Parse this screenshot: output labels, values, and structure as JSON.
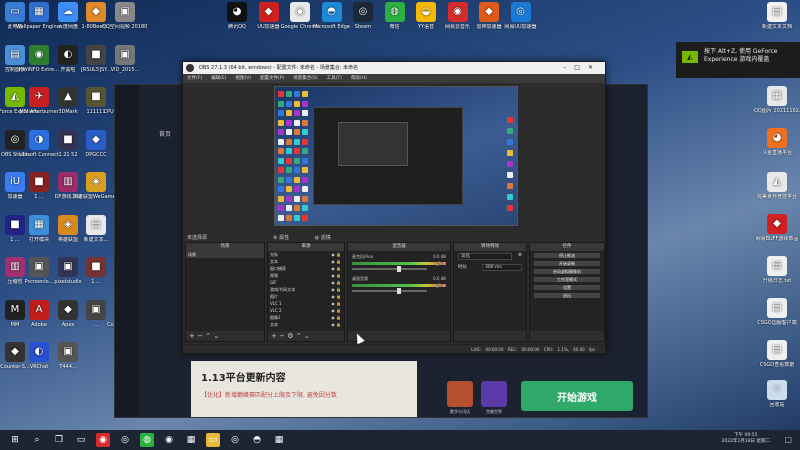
{
  "desktop_left": [
    {
      "label": "此电脑",
      "icon": "computer-icon",
      "color": "#3a7bd5",
      "glyph": "▭"
    },
    {
      "label": "Wallpaper Engine: ...",
      "icon": "wallpaper-engine-icon",
      "color": "#2f6fd1",
      "glyph": "▦"
    },
    {
      "label": "百度网盘",
      "icon": "baidu-netdisk-icon",
      "color": "#3e8ef7",
      "glyph": "☁"
    },
    {
      "label": "1-80Beetl...",
      "icon": "cs-game-icon",
      "color": "#e08a2c",
      "glyph": "◆"
    },
    {
      "label": "QQ空间视频 2018071...",
      "icon": "video-file-icon",
      "color": "#888",
      "glyph": "▣"
    },
    {
      "label": "控制面板",
      "icon": "control-panel-icon",
      "color": "#4a8fd8",
      "glyph": "▤"
    },
    {
      "label": "HWiNFO Extre...",
      "icon": "hwinfo-icon",
      "color": "#2d7f2d",
      "glyph": "◉"
    },
    {
      "label": "开黑啦",
      "icon": "kaiheila-icon",
      "color": "#222",
      "glyph": "◐"
    },
    {
      "label": "[RSUL5]SY...",
      "icon": "app-icon",
      "color": "#444",
      "glyph": "■"
    },
    {
      "label": "VID_2015...",
      "icon": "video-file-icon",
      "color": "#777",
      "glyph": "▣"
    },
    {
      "label": "GeForce Experience",
      "icon": "geforce-icon",
      "color": "#76b900",
      "glyph": "◭"
    },
    {
      "label": "MSI Afterburner",
      "icon": "msi-afterburner-icon",
      "color": "#c82020",
      "glyph": "✈"
    },
    {
      "label": "3DMark",
      "icon": "3dmark-icon",
      "color": "#333",
      "glyph": "▲"
    },
    {
      "label": "111111",
      "icon": "app-icon",
      "color": "#553",
      "glyph": "■"
    },
    {
      "label": "CPUID CPU-Z MSI",
      "icon": "cpuz-icon",
      "color": "#8a1c1c",
      "glyph": "▩"
    },
    {
      "label": "OBS Studio",
      "icon": "obs-icon",
      "color": "#222",
      "glyph": "◎"
    },
    {
      "label": "Ubisoft Connect",
      "icon": "ubisoft-icon",
      "color": "#2a6fe0",
      "glyph": "◑"
    },
    {
      "label": "1 21 52",
      "icon": "app-icon",
      "color": "#335",
      "glyph": "■"
    },
    {
      "label": "DPGCCC",
      "icon": "app-icon",
      "color": "#2a5dc6",
      "glyph": "◆"
    },
    {
      "label": "英雄联盟",
      "icon": "lol-icon",
      "color": "#2060c0",
      "glyph": "▲"
    },
    {
      "label": "加速器",
      "icon": "accelerator-icon",
      "color": "#3b7df0",
      "glyph": "iU"
    },
    {
      "label": "1 ...",
      "icon": "app-icon",
      "color": "#822",
      "glyph": "■"
    },
    {
      "label": "DP游戏工具",
      "icon": "winrar-icon",
      "color": "#9a2c6a",
      "glyph": "▥"
    },
    {
      "label": "英雄联盟WeGame版",
      "icon": "wegame-icon",
      "color": "#d8a020",
      "glyph": "◈"
    },
    {
      "label": "Origin",
      "icon": "origin-icon",
      "color": "#f06a20",
      "glyph": "◉"
    },
    {
      "label": "1 ...",
      "icon": "app-icon",
      "color": "#228",
      "glyph": "■"
    },
    {
      "label": "打开模块",
      "icon": "app-icon",
      "color": "#3c8fd8",
      "glyph": "▦"
    },
    {
      "label": "英雄联盟",
      "icon": "app-icon",
      "color": "#d88a20",
      "glyph": "◈"
    },
    {
      "label": "新建文本...",
      "icon": "text-file-icon",
      "color": "#e8e8e8",
      "glyph": "▤"
    },
    {
      "label": "...",
      "icon": "app-icon",
      "color": "#666",
      "glyph": "■"
    },
    {
      "label": "压缩包",
      "icon": "winrar-icon",
      "color": "#a03070",
      "glyph": "▥"
    },
    {
      "label": "Pscreenlo...",
      "icon": "app-icon",
      "color": "#555",
      "glyph": "▣"
    },
    {
      "label": "pixelstudio",
      "icon": "app-icon",
      "color": "#335",
      "glyph": "▣"
    },
    {
      "label": "1 ...",
      "icon": "app-icon",
      "color": "#733",
      "glyph": "■"
    },
    {
      "label": "Steam",
      "icon": "app-icon",
      "color": "#555",
      "glyph": "▣"
    },
    {
      "label": "MM",
      "icon": "app-icon",
      "color": "#222",
      "glyph": "M"
    },
    {
      "label": "Adobe",
      "icon": "adobe-icon",
      "color": "#c21c1c",
      "glyph": "A"
    },
    {
      "label": "Apex",
      "icon": "app-icon",
      "color": "#333",
      "glyph": "◆"
    },
    {
      "label": "...",
      "icon": "app-icon",
      "color": "#444",
      "glyph": "▣"
    },
    {
      "label": "Counter-Strike",
      "icon": "cs-icon",
      "color": "#d67a1a",
      "glyph": "◆"
    },
    {
      "label": "Counter-S...",
      "icon": "cs-icon",
      "color": "#333",
      "glyph": "◆"
    },
    {
      "label": "VRChat",
      "icon": "app-icon",
      "color": "#2a4fd0",
      "glyph": "◐"
    },
    {
      "label": "T444...",
      "icon": "app-icon",
      "color": "#555",
      "glyph": "▣"
    }
  ],
  "desktop_top": [
    {
      "label": "腾讯QQ",
      "icon": "qq-icon",
      "color": "#111",
      "glyph": "◕"
    },
    {
      "label": "UU加速器",
      "icon": "gamecenter-icon",
      "color": "#d02020",
      "glyph": "◆"
    },
    {
      "label": "Google Chrome",
      "icon": "chrome-icon",
      "color": "#e8e8e8",
      "glyph": "◉"
    },
    {
      "label": "Microsoft Edge",
      "icon": "edge-icon",
      "color": "#1e8ad6",
      "glyph": "◓"
    },
    {
      "label": "Steam",
      "icon": "steam-icon",
      "color": "#1b2838",
      "glyph": "◎"
    },
    {
      "label": "微信",
      "icon": "wechat-icon",
      "color": "#2bb140",
      "glyph": "◍"
    },
    {
      "label": "YY语音",
      "icon": "yy-icon",
      "color": "#f5b800",
      "glyph": "◒"
    },
    {
      "label": "网易云音乐",
      "icon": "netease-music-icon",
      "color": "#d42c2c",
      "glyph": "◉"
    },
    {
      "label": "雷神加速器",
      "icon": "leishen-icon",
      "color": "#e05a1a",
      "glyph": "◆"
    },
    {
      "label": "网易UU加速器",
      "icon": "uu-icon",
      "color": "#1a7ad6",
      "glyph": "◎"
    }
  ],
  "desktop_right": [
    {
      "label": "新建文本文档",
      "icon": "text-file-icon",
      "color": "#f0f0f0",
      "glyph": "▤"
    },
    {
      "label": "QQ图片 20211102...",
      "icon": "image-file-icon",
      "color": "#e8e8e8",
      "glyph": "▦"
    },
    {
      "label": "斗鱼直播平台",
      "icon": "douyu-icon",
      "color": "#f07020",
      "glyph": "◕"
    },
    {
      "label": "完美世界竞技平台",
      "icon": "perfect-world-icon",
      "color": "#e8e8e8",
      "glyph": "◭"
    },
    {
      "label": "网易BUFF游戏饰品",
      "icon": "buff-icon",
      "color": "#d02020",
      "glyph": "◆"
    },
    {
      "label": "升级日志.txt",
      "icon": "text-file-icon",
      "color": "#f0f0f0",
      "glyph": "▤"
    },
    {
      "label": "CSGO国服客户端",
      "icon": "text-file-icon",
      "color": "#f0f0f0",
      "glyph": "▤"
    },
    {
      "label": "CSGO查看数据",
      "icon": "text-file-icon",
      "color": "#f0f0f0",
      "glyph": "▤"
    },
    {
      "label": "回收站",
      "icon": "recycle-bin-icon",
      "color": "#cde",
      "glyph": "♲"
    }
  ],
  "obs": {
    "title": "OBS 27.1.3 (64 bit, windows) - 配置文件: 未命名 - 场景集合: 未命名",
    "menu": [
      "文件(F)",
      "编辑(E)",
      "视图(V)",
      "配置文件(P)",
      "场景集合(S)",
      "工具(T)",
      "帮助(H)"
    ],
    "no_source": "未选择源",
    "props_tab": "属性",
    "filters_tab": "滤镜",
    "docks": {
      "scenes": {
        "title": "场景",
        "items": [
          "场景"
        ]
      },
      "sources": {
        "title": "来源",
        "items": [
          "光标",
          "文本",
          "窗口捕获",
          "视频",
          "GIF",
          "游戏/代码文本",
          "图片",
          "VLC 1",
          "VLC 2",
          "图像2",
          "文本"
        ]
      },
      "mixer": {
        "title": "混音器",
        "channels": [
          {
            "name": "麦克风/Aux",
            "db": "0.0 dB"
          },
          {
            "name": "桌面音频",
            "db": "0.0 dB"
          }
        ]
      },
      "transitions": {
        "title": "转场特效",
        "type_value": "淡化",
        "duration_label": "时长",
        "duration_value": "300 ms"
      },
      "controls": {
        "title": "控件",
        "buttons": [
          "停止推流",
          "开始录制",
          "启动虚拟摄像机",
          "工作室模式",
          "设置",
          "退出"
        ]
      }
    },
    "status": [
      "LIVE: 00:00:00",
      "REC: 00:00:00",
      "CPU: 1.1%, 60.00 fps"
    ]
  },
  "bgapp": {
    "home_tab": "首页",
    "news_title": "1.13平台更新内容",
    "news_sub": "【优化】新增巅峰赛匹配分上限及下限, 避免因分数",
    "start_label": "开始游戏",
    "side_labels": [
      "数字与讯达",
      "完美世界"
    ]
  },
  "notification": {
    "text": "按下 Alt+Z, 使用 GeForce Experience 游戏内覆盖",
    "brand_glyph": "◭"
  },
  "taskbar": {
    "time": "下午 09:55",
    "date": "2022年1月18日 星期二",
    "apps": [
      {
        "icon": "start-icon",
        "glyph": "⊞",
        "color": "transparent"
      },
      {
        "icon": "search-icon",
        "glyph": "⌕",
        "color": "transparent"
      },
      {
        "icon": "task-view-icon",
        "glyph": "❐",
        "color": "transparent"
      },
      {
        "icon": "app-icon",
        "glyph": "▭",
        "color": "transparent"
      },
      {
        "icon": "netease-music-icon",
        "glyph": "◉",
        "color": "#d42c2c"
      },
      {
        "icon": "app-icon",
        "glyph": "◎",
        "color": "transparent"
      },
      {
        "icon": "wechat-icon",
        "glyph": "◍",
        "color": "#2bb140"
      },
      {
        "icon": "chrome-icon",
        "glyph": "◉",
        "color": "transparent"
      },
      {
        "icon": "app-icon",
        "glyph": "▦",
        "color": "transparent"
      },
      {
        "icon": "folder-icon",
        "glyph": "▭",
        "color": "#e8b93a"
      },
      {
        "icon": "obs-icon",
        "glyph": "◎",
        "color": "transparent"
      },
      {
        "icon": "app-icon",
        "glyph": "◓",
        "color": "transparent"
      },
      {
        "icon": "app-icon",
        "glyph": "▦",
        "color": "transparent"
      }
    ]
  }
}
